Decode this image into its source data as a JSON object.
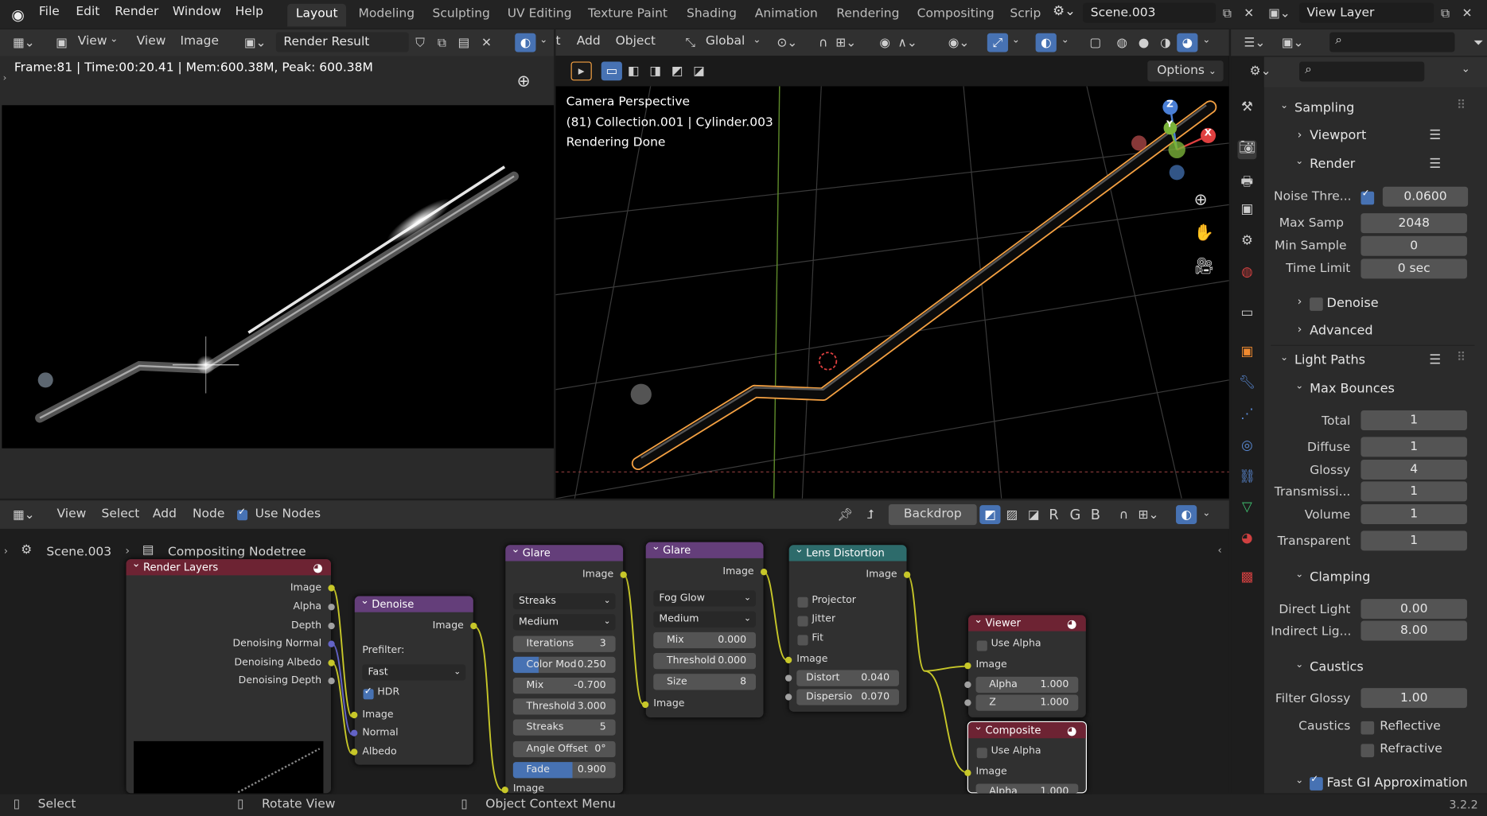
{
  "menu": {
    "items": [
      "File",
      "Edit",
      "Render",
      "Window",
      "Help"
    ]
  },
  "workspaces": [
    "Layout",
    "Modeling",
    "Sculpting",
    "UV Editing",
    "Texture Paint",
    "Shading",
    "Animation",
    "Rendering",
    "Compositing",
    "Scrip"
  ],
  "scene": "Scene.003",
  "view_layer": "View Layer",
  "image_editor": {
    "menus": [
      "View",
      "View",
      "Image"
    ],
    "image_name": "Render Result",
    "stats": "Frame:81 | Time:00:20.41 | Mem:600.38M, Peak: 600.38M"
  },
  "viewport": {
    "menus": [
      "t",
      "Add",
      "Object"
    ],
    "orientation": "Global",
    "options": "Options",
    "info": [
      "Camera Perspective",
      "(81) Collection.001 | Cylinder.003",
      "Rendering Done"
    ],
    "gizmo": {
      "z": "Z",
      "y": "Y",
      "x": "X"
    }
  },
  "node_editor": {
    "menus": [
      "View",
      "Select",
      "Add",
      "Node"
    ],
    "use_nodes": "Use Nodes",
    "backdrop": "Backdrop",
    "channels": [
      "R",
      "G",
      "B"
    ],
    "breadcrumb": [
      "Scene.003",
      "Compositing Nodetree"
    ],
    "nodes": {
      "render_layers": {
        "title": "Render Layers",
        "outputs": [
          "Image",
          "Alpha",
          "Depth",
          "Denoising Normal",
          "Denoising Albedo",
          "Denoising Depth"
        ]
      },
      "denoise": {
        "title": "Denoise",
        "out": "Image",
        "prefilter_label": "Prefilter:",
        "prefilter": "Fast",
        "hdr": "HDR",
        "inputs": [
          "Image",
          "Normal",
          "Albedo"
        ]
      },
      "glare1": {
        "title": "Glare",
        "out": "Image",
        "type": "Streaks",
        "quality": "Medium",
        "fields": [
          {
            "l": "Iterations",
            "v": "3"
          },
          {
            "l": "Color Mod",
            "v": "0.250"
          },
          {
            "l": "Mix",
            "v": "-0.700"
          },
          {
            "l": "Threshold",
            "v": "3.000"
          },
          {
            "l": "Streaks",
            "v": "5"
          },
          {
            "l": "Angle Offset",
            "v": "0°"
          },
          {
            "l": "Fade",
            "v": "0.900"
          }
        ],
        "in": "Image"
      },
      "glare2": {
        "title": "Glare",
        "out": "Image",
        "type": "Fog Glow",
        "quality": "Medium",
        "fields": [
          {
            "l": "Mix",
            "v": "0.000"
          },
          {
            "l": "Threshold",
            "v": "0.000"
          },
          {
            "l": "Size",
            "v": "8"
          }
        ],
        "in": "Image"
      },
      "lens": {
        "title": "Lens Distortion",
        "out": "Image",
        "checks": [
          "Projector",
          "Jitter",
          "Fit"
        ],
        "in": "Image",
        "fields": [
          {
            "l": "Distort",
            "v": "0.040"
          },
          {
            "l": "Dispersio",
            "v": "0.070"
          }
        ]
      },
      "viewer": {
        "title": "Viewer",
        "use_alpha": "Use Alpha",
        "in": "Image",
        "fields": [
          {
            "l": "Alpha",
            "v": "1.000"
          },
          {
            "l": "Z",
            "v": "1.000"
          }
        ]
      },
      "composite": {
        "title": "Composite",
        "use_alpha": "Use Alpha",
        "in": "Image",
        "fields": [
          {
            "l": "Alpha",
            "v": "1.000"
          }
        ]
      }
    }
  },
  "properties": {
    "sampling": "Sampling",
    "viewport": "Viewport",
    "render": "Render",
    "noise_threshold": {
      "l": "Noise Thre...",
      "v": "0.0600"
    },
    "max_samples": {
      "l": "Max Samp",
      "v": "2048"
    },
    "min_samples": {
      "l": "Min Sample",
      "v": "0"
    },
    "time_limit": {
      "l": "Time Limit",
      "v": "0 sec"
    },
    "denoise": "Denoise",
    "advanced": "Advanced",
    "light_paths": "Light Paths",
    "max_bounces": "Max Bounces",
    "bounces": [
      {
        "l": "Total",
        "v": "1"
      },
      {
        "l": "Diffuse",
        "v": "1"
      },
      {
        "l": "Glossy",
        "v": "4"
      },
      {
        "l": "Transmissi...",
        "v": "1"
      },
      {
        "l": "Volume",
        "v": "1"
      },
      {
        "l": "Transparent",
        "v": "1"
      }
    ],
    "clamping": "Clamping",
    "direct_light": {
      "l": "Direct Light",
      "v": "0.00"
    },
    "indirect_light": {
      "l": "Indirect Lig...",
      "v": "8.00"
    },
    "caustics": "Caustics",
    "filter_glossy": {
      "l": "Filter Glossy",
      "v": "1.00"
    },
    "caustics_label": "Caustics",
    "reflective": "Reflective",
    "refractive": "Refractive",
    "fast_gi": "Fast GI Approximation"
  },
  "status": {
    "select": "Select",
    "rotate": "Rotate View",
    "context": "Object Context Menu",
    "version": "3.2.2"
  },
  "colors": {
    "accent": "#4772b3",
    "selection": "#f5a142",
    "node_input": "#c7c729"
  }
}
